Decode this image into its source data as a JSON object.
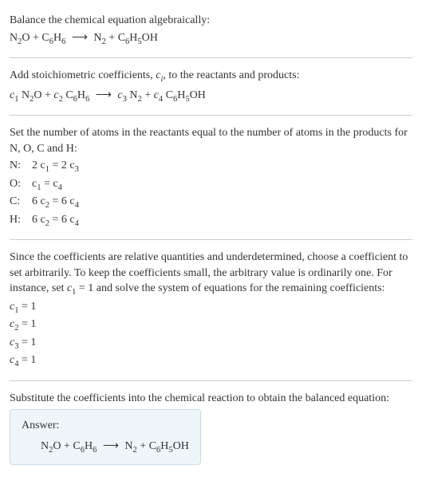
{
  "intro": {
    "line1": "Balance the chemical equation algebraically:",
    "eq_lhs1": "N",
    "eq_lhs1_sub": "2",
    "eq_lhs2": "O + C",
    "eq_lhs2_sub": "6",
    "eq_lhs3": "H",
    "eq_lhs3_sub": "6",
    "arrow": "⟶",
    "eq_rhs1": "N",
    "eq_rhs1_sub": "2",
    "eq_rhs2": " + C",
    "eq_rhs2_sub": "6",
    "eq_rhs3": "H",
    "eq_rhs3_sub": "5",
    "eq_rhs4": "OH"
  },
  "step2": {
    "text1": "Add stoichiometric coefficients, ",
    "ci": "c",
    "ci_sub": "i",
    "text2": ", to the reactants and products:",
    "c1": "c",
    "c1_sub": "1",
    "sp1": " N",
    "sp1_sub": "2",
    "sp1b": "O + ",
    "c2": "c",
    "c2_sub": "2",
    "sp2": " C",
    "sp2_sub": "6",
    "sp2b": "H",
    "sp2b_sub": "6",
    "arrow": "⟶",
    "c3": "c",
    "c3_sub": "3",
    "sp3": " N",
    "sp3_sub": "2",
    "sp3b": " + ",
    "c4": "c",
    "c4_sub": "4",
    "sp4": " C",
    "sp4_sub": "6",
    "sp4b": "H",
    "sp4b_sub": "5",
    "sp4c": "OH"
  },
  "step3": {
    "text": "Set the number of atoms in the reactants equal to the number of atoms in the products for N, O, C and H:",
    "rows": [
      {
        "label": "N:",
        "lhs_c": "2 c",
        "lhs_sub": "1",
        "eq": " = 2 c",
        "rhs_sub": "3"
      },
      {
        "label": "O:",
        "lhs_c": "c",
        "lhs_sub": "1",
        "eq": " = c",
        "rhs_sub": "4"
      },
      {
        "label": "C:",
        "lhs_c": "6 c",
        "lhs_sub": "2",
        "eq": " = 6 c",
        "rhs_sub": "4"
      },
      {
        "label": "H:",
        "lhs_c": "6 c",
        "lhs_sub": "2",
        "eq": " = 6 c",
        "rhs_sub": "4"
      }
    ]
  },
  "step4": {
    "text1": "Since the coefficients are relative quantities and underdetermined, choose a coefficient to set arbitrarily. To keep the coefficients small, the arbitrary value is ordinarily one. For instance, set ",
    "cvar": "c",
    "cvar_sub": "1",
    "text2": " = 1 and solve the system of equations for the remaining coefficients:",
    "results": [
      {
        "c": "c",
        "sub": "1",
        "val": " = 1"
      },
      {
        "c": "c",
        "sub": "2",
        "val": " = 1"
      },
      {
        "c": "c",
        "sub": "3",
        "val": " = 1"
      },
      {
        "c": "c",
        "sub": "4",
        "val": " = 1"
      }
    ]
  },
  "step5": {
    "text": "Substitute the coefficients into the chemical reaction to obtain the balanced equation:"
  },
  "answer": {
    "label": "Answer:",
    "eq_lhs1": "N",
    "eq_lhs1_sub": "2",
    "eq_lhs2": "O + C",
    "eq_lhs2_sub": "6",
    "eq_lhs3": "H",
    "eq_lhs3_sub": "6",
    "arrow": "⟶",
    "eq_rhs1": "N",
    "eq_rhs1_sub": "2",
    "eq_rhs2": " + C",
    "eq_rhs2_sub": "6",
    "eq_rhs3": "H",
    "eq_rhs3_sub": "5",
    "eq_rhs4": "OH"
  }
}
